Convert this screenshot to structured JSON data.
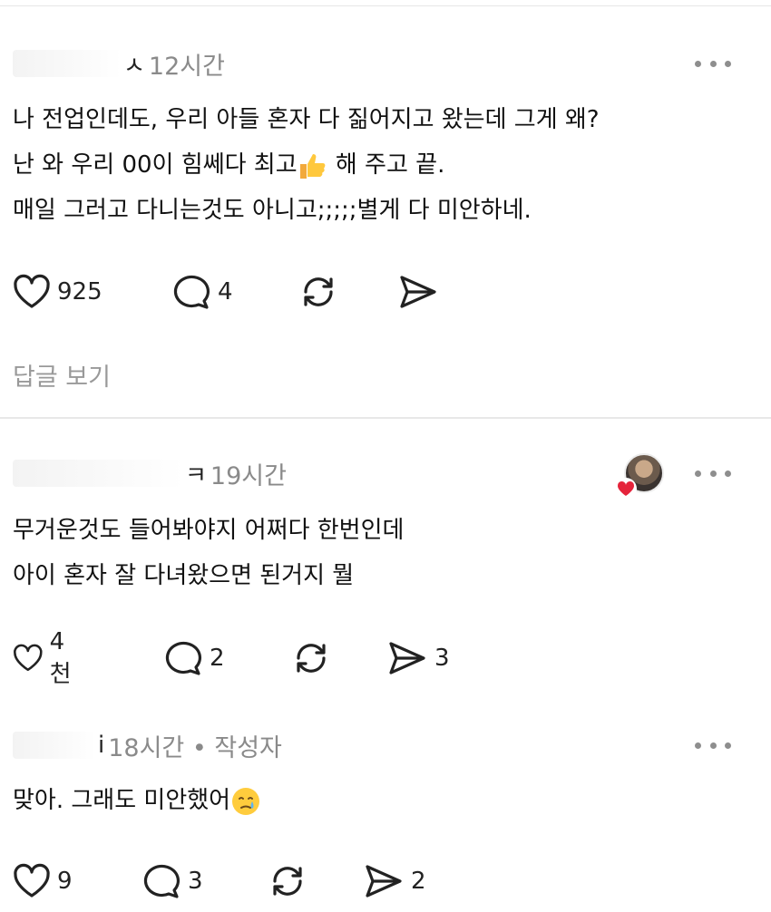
{
  "posts": [
    {
      "name_tail": "ㅅ",
      "time": "12시간",
      "lines": [
        "나 전업인데도, 우리 아들  혼자 다 짊어지고 왔는데 그게 왜?",
        "난 와 우리 00이 힘쎄다 최고",
        "매일 그러고 다니는것도 아니고;;;;;별게 다 미안하네."
      ],
      "line2_after_emoji": " 해 주고 끝.",
      "emoji": "thumbs-up",
      "likes": "925",
      "comments": "4",
      "shares": "",
      "view_replies": "답글 보기"
    },
    {
      "name_tail": "ㅋ",
      "time": "19시간",
      "lines": [
        "무거운것도 들어봐야지 어쩌다 한번인데",
        "아이 혼자 잘 다녀왔으면 된거지 뭘"
      ],
      "likes": "4천",
      "comments": "2",
      "shares": "3",
      "has_liked_avatar": true
    },
    {
      "name_tail": "i",
      "time": "18시간 • 작성자",
      "lines": [
        "맞아. 그래도 미안했어"
      ],
      "emoji": "crying-face",
      "likes": "9",
      "comments": "3",
      "shares": "2"
    }
  ],
  "colors": {
    "text": "#111111",
    "muted": "#8a8a8a",
    "icon": "#222222",
    "heart": "#e5243b"
  }
}
